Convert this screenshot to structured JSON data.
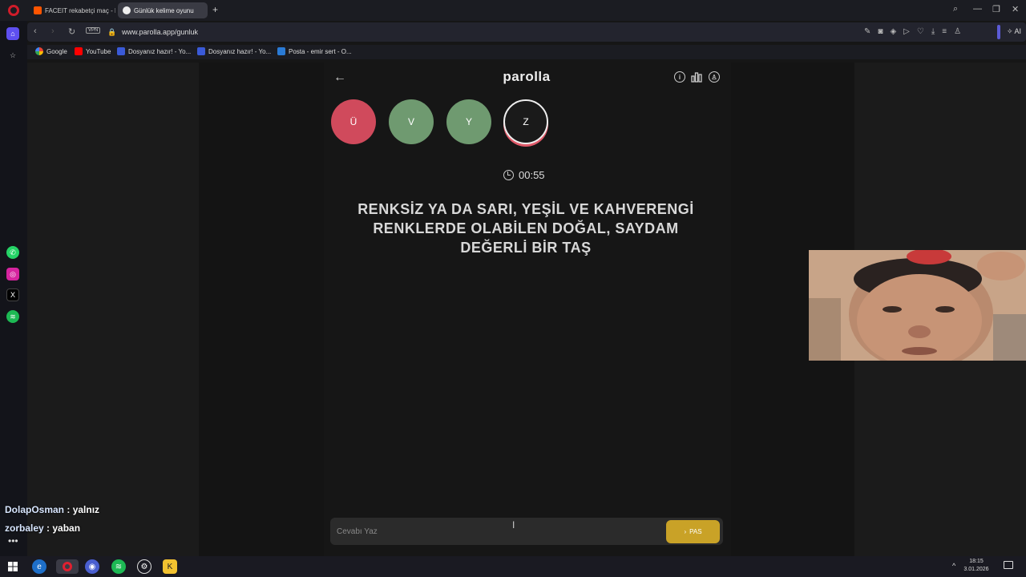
{
  "browser": {
    "tabs": [
      {
        "label": "FACEIT rekabetçi maç - FA",
        "icon": "faceit-icon"
      },
      {
        "label": "Günlük kelime oyunu",
        "icon": "parolla-icon"
      }
    ],
    "url": "www.parolla.app/gunluk",
    "vpn_label": "VPN",
    "ai_label": "AI",
    "bookmarks": [
      {
        "label": "Google",
        "icon": "google-icon"
      },
      {
        "label": "YouTube",
        "icon": "youtube-icon"
      },
      {
        "label": "Dosyanız hazır! - Yo...",
        "icon": "bookmark-icon"
      },
      {
        "label": "Dosyanız hazır! - Yo...",
        "icon": "bookmark-icon"
      },
      {
        "label": "Posta - emir sert - O...",
        "icon": "mail-icon"
      }
    ]
  },
  "app": {
    "brand": "parolla",
    "letters": [
      {
        "letter": "Ü",
        "state": "wrong",
        "color": "#d04a5c"
      },
      {
        "letter": "V",
        "state": "correct",
        "color": "#6f9a70"
      },
      {
        "letter": "Y",
        "state": "correct",
        "color": "#6f9a70"
      },
      {
        "letter": "Z",
        "state": "current",
        "color": "#1a1a1a"
      }
    ],
    "timer": "00:55",
    "question": "RENKSİZ YA DA SARI, YEŞİL VE KAHVERENGİ RENKLERDE OLABİLEN DOĞAL, SAYDAM DEĞERLİ BİR TAŞ",
    "answer_placeholder": "Cevabı Yaz",
    "pass_label": "PAS",
    "pass_color": "#c9a227"
  },
  "chat": [
    {
      "user": "DolapOsman",
      "message": "yalnız"
    },
    {
      "user": "zorbaley",
      "message": "yaban"
    }
  ],
  "taskbar": {
    "time": "18:15",
    "date": "3.01.2026"
  }
}
